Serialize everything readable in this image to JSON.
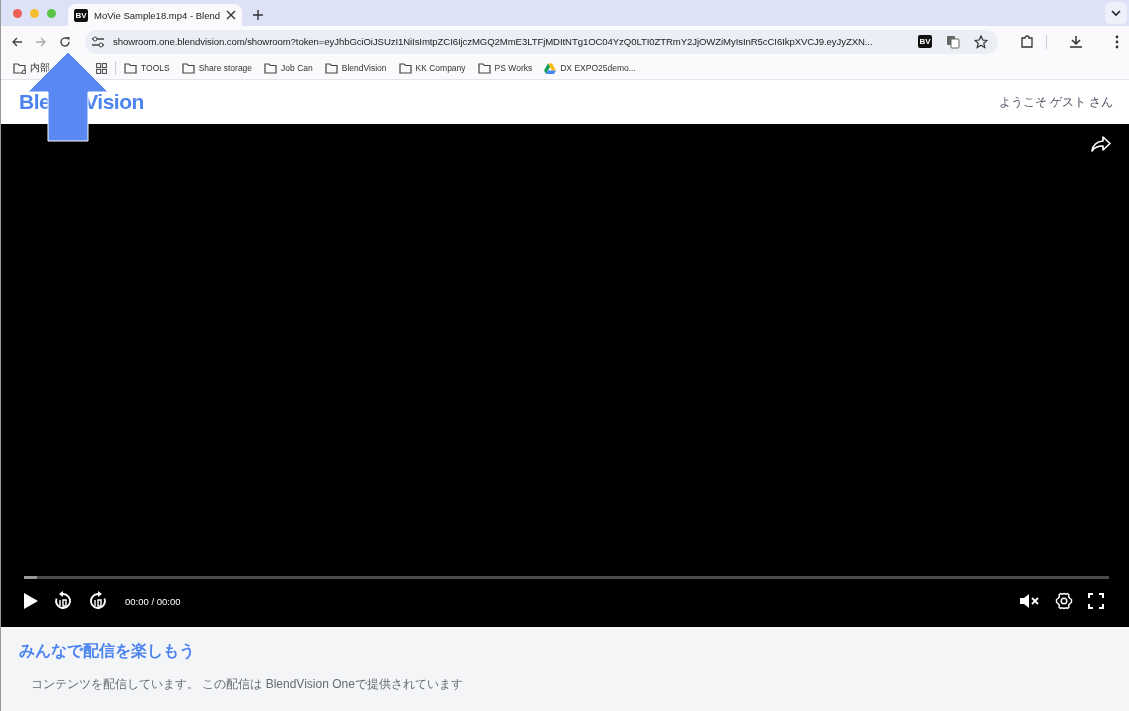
{
  "browser": {
    "tabs": [
      {
        "title": "MoVie Sample18.mp4 - Blend",
        "selected": true
      }
    ],
    "address": "showroom.one.blendvision.com/showroom?token=eyJhbGciOiJSUzI1NiIsImtpZCI6IjczMGQ2MmE3LTFjMDItNTg1OC04YzQ0LTI0ZTRmY2JjOWZiMyIsInR5cCI6IkpXVCJ9.eyJyZXN...",
    "favicon_text": "BV",
    "extension_text": "BV",
    "bookmarks": [
      {
        "label": "内部",
        "kind": "folder-gear"
      },
      {
        "kind": "apps"
      },
      {
        "label": "TOOLS",
        "kind": "folder"
      },
      {
        "label": "Share storage",
        "kind": "folder"
      },
      {
        "label": "Job Can",
        "kind": "folder"
      },
      {
        "label": "BlendVision",
        "kind": "folder"
      },
      {
        "label": "KK Company",
        "kind": "folder"
      },
      {
        "label": "PS Works",
        "kind": "folder"
      },
      {
        "label": "DX EXPO25demo...",
        "kind": "drive"
      }
    ]
  },
  "header": {
    "logo_parts": [
      "Ble",
      "Vision"
    ],
    "welcome": "ようこそ ゲスト さん"
  },
  "player": {
    "progress": {
      "level": 0.012
    },
    "time": "00:00 / 00:00",
    "muted": true
  },
  "footer": {
    "title": "みんなで配信を楽しもう",
    "description": "コンテンツを配信しています。 この配信は BlendVision Oneで提供されています"
  }
}
